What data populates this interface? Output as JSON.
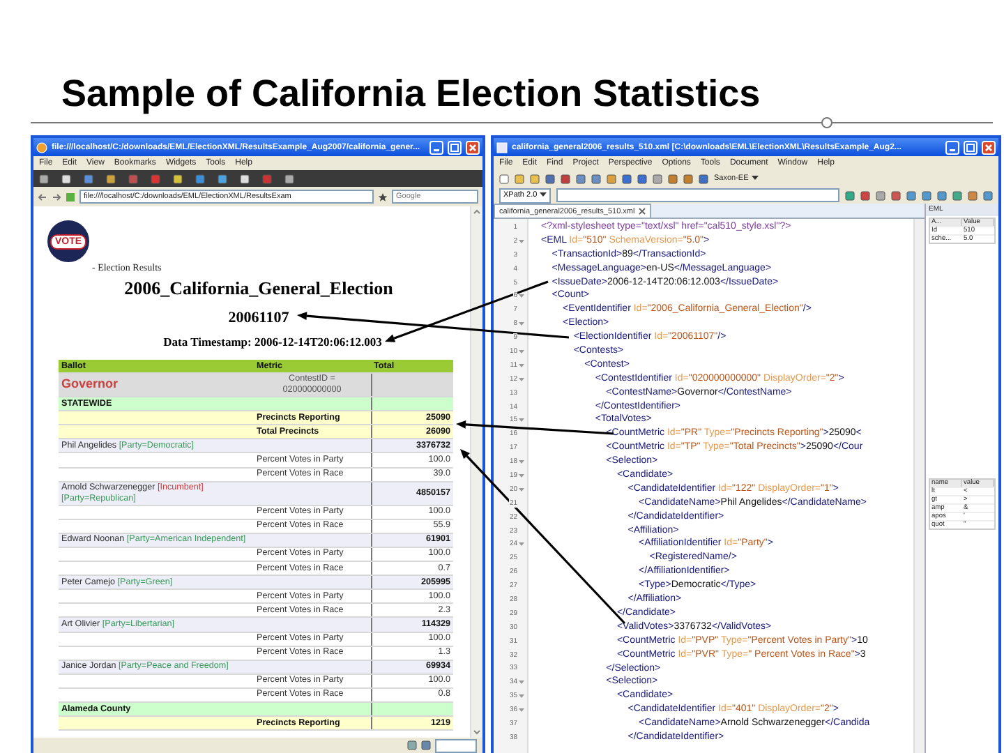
{
  "slide_title": "Sample of California Election Statistics",
  "browser": {
    "title": "file:///localhost/C:/downloads/EML/ElectionXML/ResultsExample_Aug2007/california_gener...",
    "menu": [
      "File",
      "Edit",
      "View",
      "Bookmarks",
      "Widgets",
      "Tools",
      "Help"
    ],
    "address": "file:///localhost/C:/downloads/EML/ElectionXML/ResultsExam",
    "search": {
      "placeholder": "Google"
    },
    "page": {
      "logo": "VOTE",
      "subtitle": "- Election Results",
      "election": "2006_California_General_Election",
      "date": "20061107",
      "timestamp": "Data Timestamp: 2006-12-14T20:06:12.003"
    },
    "table": {
      "rows": [
        {
          "kind": "header",
          "ballot": "Ballot",
          "metric": "Metric",
          "total": "Total"
        },
        {
          "kind": "contest",
          "ballot": "Governor",
          "metric": "ContestID = 020000000000"
        },
        {
          "kind": "region",
          "ballot": "STATEWIDE"
        },
        {
          "kind": "summary",
          "metric": "Precincts Reporting",
          "total": "25090"
        },
        {
          "kind": "summary",
          "metric": "Total Precincts",
          "total": "26090"
        },
        {
          "kind": "candidate",
          "ballot": "Phil Angelides",
          "tags": [
            {
              "kind": "party",
              "text": "[Party=Democratic]"
            }
          ],
          "total": "3376732"
        },
        {
          "kind": "percent",
          "metric": "Percent Votes in Party",
          "total": "100.0"
        },
        {
          "kind": "percent",
          "metric": "Percent Votes in Race",
          "total": "39.0"
        },
        {
          "kind": "candidate",
          "ballot": "Arnold Schwarzenegger",
          "tags": [
            {
              "kind": "incumbent",
              "text": "[Incumbent]"
            },
            {
              "kind": "party",
              "text": "[Party=Republican]"
            }
          ],
          "total": "4850157"
        },
        {
          "kind": "percent",
          "metric": "Percent Votes in Party",
          "total": "100.0"
        },
        {
          "kind": "percent",
          "metric": "Percent Votes in Race",
          "total": "55.9"
        },
        {
          "kind": "candidate",
          "ballot": "Edward Noonan",
          "tags": [
            {
              "kind": "party",
              "text": "[Party=American Independent]"
            }
          ],
          "total": "61901"
        },
        {
          "kind": "percent",
          "metric": "Percent Votes in Party",
          "total": "100.0"
        },
        {
          "kind": "percent",
          "metric": "Percent Votes in Race",
          "total": "0.7"
        },
        {
          "kind": "candidate",
          "ballot": "Peter Camejo",
          "tags": [
            {
              "kind": "party",
              "text": "[Party=Green]"
            }
          ],
          "total": "205995"
        },
        {
          "kind": "percent",
          "metric": "Percent Votes in Party",
          "total": "100.0"
        },
        {
          "kind": "percent",
          "metric": "Percent Votes in Race",
          "total": "2.3"
        },
        {
          "kind": "candidate",
          "ballot": "Art Olivier",
          "tags": [
            {
              "kind": "party",
              "text": "[Party=Libertarian]"
            }
          ],
          "total": "114329"
        },
        {
          "kind": "percent",
          "metric": "Percent Votes in Party",
          "total": "100.0"
        },
        {
          "kind": "percent",
          "metric": "Percent Votes in Race",
          "total": "1.3"
        },
        {
          "kind": "candidate",
          "ballot": "Janice Jordan",
          "tags": [
            {
              "kind": "party",
              "text": "[Party=Peace and Freedom]"
            }
          ],
          "total": "69934"
        },
        {
          "kind": "percent",
          "metric": "Percent Votes in Party",
          "total": "100.0"
        },
        {
          "kind": "percent",
          "metric": "Percent Votes in Race",
          "total": "0.8"
        },
        {
          "kind": "region",
          "ballot": "Alameda County"
        },
        {
          "kind": "summary",
          "metric": "Precincts Reporting",
          "total": "1219"
        }
      ]
    }
  },
  "editor": {
    "title": "california_general2006_results_510.xml [C:\\downloads\\EML\\ElectionXML\\ResultsExample_Aug2...",
    "menu": [
      "File",
      "Edit",
      "Find",
      "Project",
      "Perspective",
      "Options",
      "Tools",
      "Document",
      "Window",
      "Help"
    ],
    "processor": "Saxon-EE",
    "xpath_version": "XPath 2.0",
    "tab": "california_general2006_results_510.xml",
    "lines": [
      {
        "number": "1",
        "foldable": false,
        "tokens": [
          {
            "kind": "pi",
            "text": "<?xml-stylesheet type=\"text/xsl\" href=\"cal510_style.xsl\"?>"
          }
        ]
      },
      {
        "number": "2",
        "foldable": true,
        "tokens": [
          {
            "kind": "tag",
            "text": "<EML"
          },
          {
            "kind": "attr",
            "text": " Id="
          },
          {
            "kind": "value",
            "text": "\"510\""
          },
          {
            "kind": "attr",
            "text": " SchemaVersion="
          },
          {
            "kind": "value",
            "text": "\"5.0\""
          },
          {
            "kind": "tag",
            "text": ">"
          }
        ]
      },
      {
        "number": "3",
        "foldable": false,
        "tokens": [
          {
            "kind": "tag",
            "text": "    <TransactionId>"
          },
          {
            "kind": "text",
            "text": "89"
          },
          {
            "kind": "tag",
            "text": "</TransactionId>"
          }
        ]
      },
      {
        "number": "4",
        "foldable": false,
        "tokens": [
          {
            "kind": "tag",
            "text": "    <MessageLanguage>"
          },
          {
            "kind": "text",
            "text": "en-US"
          },
          {
            "kind": "tag",
            "text": "</MessageLanguage>"
          }
        ]
      },
      {
        "number": "5",
        "foldable": false,
        "tokens": [
          {
            "kind": "tag",
            "text": "    <IssueDate>"
          },
          {
            "kind": "text",
            "text": "2006-12-14T20:06:12.003"
          },
          {
            "kind": "tag",
            "text": "</IssueDate>"
          }
        ]
      },
      {
        "number": "6",
        "foldable": true,
        "tokens": [
          {
            "kind": "tag",
            "text": "    <Count>"
          }
        ]
      },
      {
        "number": "7",
        "foldable": false,
        "tokens": [
          {
            "kind": "tag",
            "text": "        <EventIdentifier"
          },
          {
            "kind": "attr",
            "text": " Id="
          },
          {
            "kind": "value",
            "text": "\"2006_California_General_Election\""
          },
          {
            "kind": "tag",
            "text": "/>"
          }
        ]
      },
      {
        "number": "8",
        "foldable": true,
        "tokens": [
          {
            "kind": "tag",
            "text": "        <Election>"
          }
        ]
      },
      {
        "number": "9",
        "foldable": false,
        "tokens": [
          {
            "kind": "tag",
            "text": "            <ElectionIdentifier"
          },
          {
            "kind": "attr",
            "text": " Id="
          },
          {
            "kind": "value",
            "text": "\"20061107\""
          },
          {
            "kind": "tag",
            "text": "/>"
          }
        ]
      },
      {
        "number": "10",
        "foldable": true,
        "tokens": [
          {
            "kind": "tag",
            "text": "            <Contests>"
          }
        ]
      },
      {
        "number": "11",
        "foldable": true,
        "tokens": [
          {
            "kind": "tag",
            "text": "                <Contest>"
          }
        ]
      },
      {
        "number": "12",
        "foldable": true,
        "tokens": [
          {
            "kind": "tag",
            "text": "                    <ContestIdentifier"
          },
          {
            "kind": "attr",
            "text": " Id="
          },
          {
            "kind": "value",
            "text": "\"020000000000\""
          },
          {
            "kind": "attr",
            "text": " DisplayOrder="
          },
          {
            "kind": "value",
            "text": "\"2\""
          },
          {
            "kind": "tag",
            "text": ">"
          }
        ]
      },
      {
        "number": "13",
        "foldable": false,
        "tokens": [
          {
            "kind": "tag",
            "text": "                        <ContestName>"
          },
          {
            "kind": "text",
            "text": "Governor"
          },
          {
            "kind": "tag",
            "text": "</ContestName>"
          }
        ]
      },
      {
        "number": "14",
        "foldable": false,
        "tokens": [
          {
            "kind": "tag",
            "text": "                    </ContestIdentifier>"
          }
        ]
      },
      {
        "number": "15",
        "foldable": true,
        "tokens": [
          {
            "kind": "tag",
            "text": "                    <TotalVotes>"
          }
        ]
      },
      {
        "number": "16",
        "foldable": false,
        "tokens": [
          {
            "kind": "tag",
            "text": "                        <CountMetric"
          },
          {
            "kind": "attr",
            "text": " Id="
          },
          {
            "kind": "value",
            "text": "\"PR\""
          },
          {
            "kind": "attr",
            "text": " Type="
          },
          {
            "kind": "value",
            "text": "\"Precincts Reporting\""
          },
          {
            "kind": "tag",
            "text": ">"
          },
          {
            "kind": "text",
            "text": "25090"
          },
          {
            "kind": "tag",
            "text": "<"
          }
        ]
      },
      {
        "number": "17",
        "foldable": false,
        "tokens": [
          {
            "kind": "tag",
            "text": "                        <CountMetric"
          },
          {
            "kind": "attr",
            "text": " Id="
          },
          {
            "kind": "value",
            "text": "\"TP\""
          },
          {
            "kind": "attr",
            "text": " Type="
          },
          {
            "kind": "value",
            "text": "\"Total Precincts\""
          },
          {
            "kind": "tag",
            "text": ">"
          },
          {
            "kind": "text",
            "text": "25090"
          },
          {
            "kind": "tag",
            "text": "</Cour"
          }
        ]
      },
      {
        "number": "18",
        "foldable": true,
        "tokens": [
          {
            "kind": "tag",
            "text": "                        <Selection>"
          }
        ]
      },
      {
        "number": "19",
        "foldable": true,
        "tokens": [
          {
            "kind": "tag",
            "text": "                            <Candidate>"
          }
        ]
      },
      {
        "number": "20",
        "foldable": true,
        "tokens": [
          {
            "kind": "tag",
            "text": "                                <CandidateIdentifier"
          },
          {
            "kind": "attr",
            "text": " Id="
          },
          {
            "kind": "value",
            "text": "\"122\""
          },
          {
            "kind": "attr",
            "text": " DisplayOrder="
          },
          {
            "kind": "value",
            "text": "\"1\""
          },
          {
            "kind": "tag",
            "text": ">"
          }
        ]
      },
      {
        "number": "21",
        "foldable": false,
        "tokens": [
          {
            "kind": "tag",
            "text": "                                    <CandidateName>"
          },
          {
            "kind": "text",
            "text": "Phil Angelides"
          },
          {
            "kind": "tag",
            "text": "</CandidateName>"
          }
        ]
      },
      {
        "number": "22",
        "foldable": false,
        "tokens": [
          {
            "kind": "tag",
            "text": "                                </CandidateIdentifier>"
          }
        ]
      },
      {
        "number": "23",
        "foldable": false,
        "tokens": [
          {
            "kind": "tag",
            "text": "                                <Affiliation>"
          }
        ]
      },
      {
        "number": "24",
        "foldable": true,
        "tokens": [
          {
            "kind": "tag",
            "text": "                                    <AffiliationIdentifier"
          },
          {
            "kind": "attr",
            "text": " Id="
          },
          {
            "kind": "value",
            "text": "\"Party\""
          },
          {
            "kind": "tag",
            "text": ">"
          }
        ]
      },
      {
        "number": "25",
        "foldable": false,
        "tokens": [
          {
            "kind": "tag",
            "text": "                                        <RegisteredName/>"
          }
        ]
      },
      {
        "number": "26",
        "foldable": false,
        "tokens": [
          {
            "kind": "tag",
            "text": "                                    </AffiliationIdentifier>"
          }
        ]
      },
      {
        "number": "27",
        "foldable": false,
        "tokens": [
          {
            "kind": "tag",
            "text": "                                    <Type>"
          },
          {
            "kind": "text",
            "text": "Democratic"
          },
          {
            "kind": "tag",
            "text": "</Type>"
          }
        ]
      },
      {
        "number": "28",
        "foldable": false,
        "tokens": [
          {
            "kind": "tag",
            "text": "                                </Affiliation>"
          }
        ]
      },
      {
        "number": "29",
        "foldable": false,
        "tokens": [
          {
            "kind": "tag",
            "text": "                            </Candidate>"
          }
        ]
      },
      {
        "number": "30",
        "foldable": false,
        "tokens": [
          {
            "kind": "tag",
            "text": "                            <ValidVotes>"
          },
          {
            "kind": "text",
            "text": "3376732"
          },
          {
            "kind": "tag",
            "text": "</ValidVotes>"
          }
        ]
      },
      {
        "number": "31",
        "foldable": false,
        "tokens": [
          {
            "kind": "tag",
            "text": "                            <CountMetric"
          },
          {
            "kind": "attr",
            "text": " Id="
          },
          {
            "kind": "value",
            "text": "\"PVP\""
          },
          {
            "kind": "attr",
            "text": " Type="
          },
          {
            "kind": "value",
            "text": "\"Percent Votes in Party\""
          },
          {
            "kind": "tag",
            "text": ">"
          },
          {
            "kind": "text",
            "text": "10"
          }
        ]
      },
      {
        "number": "32",
        "foldable": false,
        "tokens": [
          {
            "kind": "tag",
            "text": "                            <CountMetric"
          },
          {
            "kind": "attr",
            "text": " Id="
          },
          {
            "kind": "value",
            "text": "\"PVR\""
          },
          {
            "kind": "attr",
            "text": " Type="
          },
          {
            "kind": "value",
            "text": "\" Percent Votes in Race\""
          },
          {
            "kind": "tag",
            "text": ">"
          },
          {
            "kind": "text",
            "text": "3"
          }
        ]
      },
      {
        "number": "33",
        "foldable": false,
        "tokens": [
          {
            "kind": "tag",
            "text": "                        </Selection>"
          }
        ]
      },
      {
        "number": "34",
        "foldable": true,
        "tokens": [
          {
            "kind": "tag",
            "text": "                        <Selection>"
          }
        ]
      },
      {
        "number": "35",
        "foldable": true,
        "tokens": [
          {
            "kind": "tag",
            "text": "                            <Candidate>"
          }
        ]
      },
      {
        "number": "36",
        "foldable": true,
        "tokens": [
          {
            "kind": "tag",
            "text": "                                <CandidateIdentifier"
          },
          {
            "kind": "attr",
            "text": " Id="
          },
          {
            "kind": "value",
            "text": "\"401\""
          },
          {
            "kind": "attr",
            "text": " DisplayOrder="
          },
          {
            "kind": "value",
            "text": "\"2\""
          },
          {
            "kind": "tag",
            "text": ">"
          }
        ]
      },
      {
        "number": "37",
        "foldable": false,
        "tokens": [
          {
            "kind": "tag",
            "text": "                                    <CandidateName>"
          },
          {
            "kind": "text",
            "text": "Arnold Schwarzenegger"
          },
          {
            "kind": "tag",
            "text": "</Candida"
          }
        ]
      },
      {
        "number": "38",
        "foldable": false,
        "tokens": [
          {
            "kind": "tag",
            "text": "                                </CandidateIdentifier>"
          }
        ]
      }
    ],
    "attributes_panel": {
      "title": "EML",
      "columns": [
        "A...",
        "Value"
      ],
      "rows": [
        [
          "Id",
          "510"
        ],
        [
          "sche...",
          "5.0"
        ]
      ]
    },
    "entities_panel": {
      "columns": [
        "name",
        "value"
      ],
      "rows": [
        [
          "lt",
          "<"
        ],
        [
          "gt",
          ">"
        ],
        [
          "amp",
          "&"
        ],
        [
          "apos",
          "'"
        ],
        [
          "quot",
          "\""
        ]
      ]
    }
  }
}
